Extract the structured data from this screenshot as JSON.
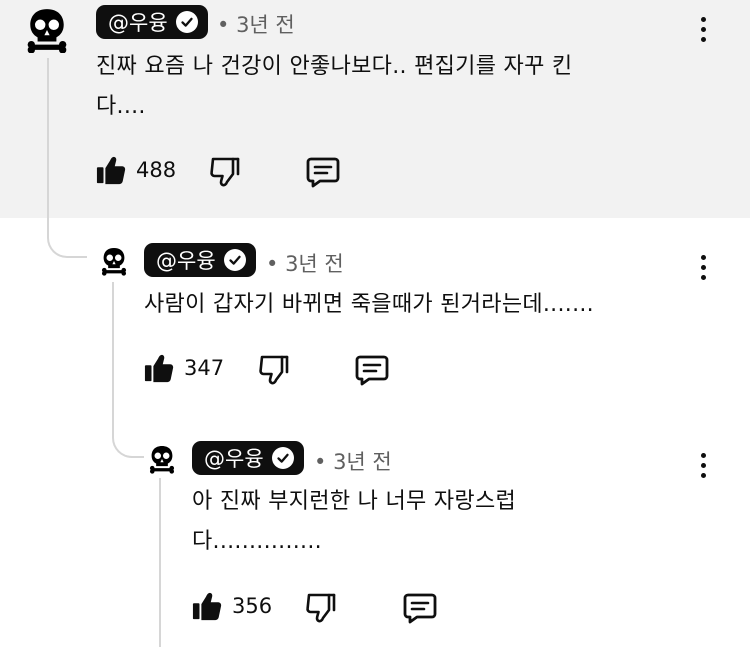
{
  "comments": [
    {
      "handle": "@우융",
      "time": "3년 전",
      "text_line1": "진짜 요즘 나 건강이 안좋나보다.. 편집기를 자꾸 킨",
      "text_line2": "다....",
      "likes": "488"
    },
    {
      "handle": "@우융",
      "time": "3년 전",
      "text_line1": "사람이 갑자기 바뀌면 죽을때가 된거라는데.......",
      "likes": "347"
    },
    {
      "handle": "@우융",
      "time": "3년 전",
      "text_line1": "아 진짜 부지런한 나 너무 자랑스럽",
      "text_line2": "다...............",
      "likes": "356"
    }
  ],
  "icons": {
    "avatar": "skull-avatar-icon",
    "verified": "checkmark-badge-icon",
    "like": "thumbs-up-icon",
    "dislike": "thumbs-down-icon",
    "reply": "reply-comment-icon",
    "menu": "more-vertical-icon"
  }
}
